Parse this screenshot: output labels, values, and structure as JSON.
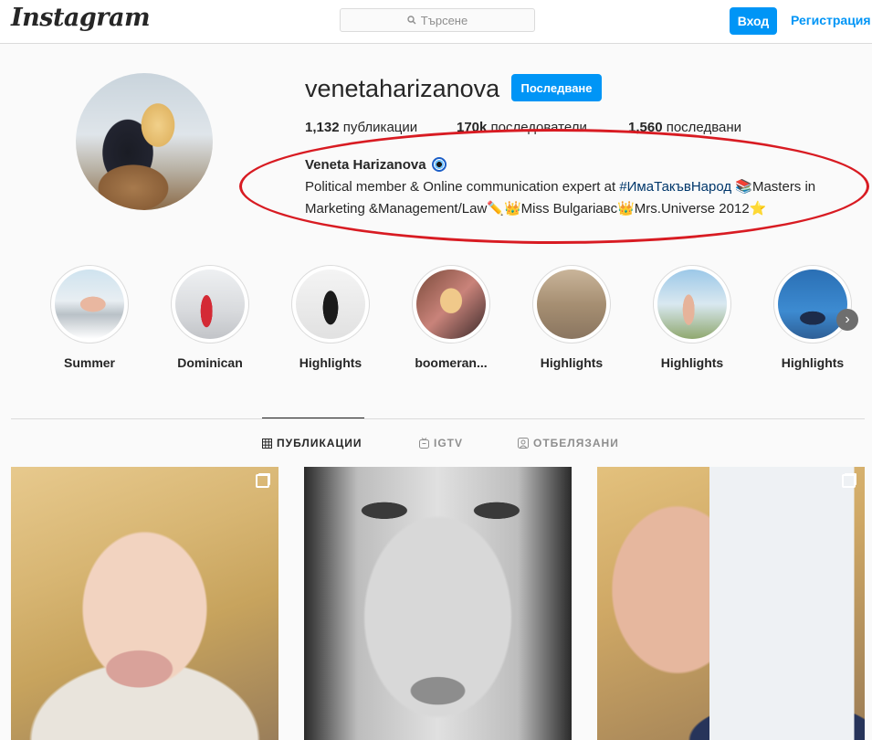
{
  "header": {
    "logo": "Instagram",
    "search_placeholder": "Търсене",
    "login_label": "Вход",
    "register_label": "Регистрация"
  },
  "profile": {
    "username": "venetaharizanova",
    "follow_label": "Последване",
    "stats": [
      {
        "count": "1,132",
        "label": "публикации"
      },
      {
        "count": "170k",
        "label": "последователи"
      },
      {
        "count": "1,560",
        "label": "последвани"
      }
    ],
    "full_name": "Veneta Harizanova",
    "bio_part1": "Political member & Online communication expert at ",
    "bio_hashtag": "#ИмаТакъвНарод",
    "bio_part2": " 📚Masters in Marketing &Management/Law✏️👑Miss Bulgariaвc👑Mrs.Universe 2012⭐"
  },
  "highlights": [
    {
      "label": "Summer"
    },
    {
      "label": "Dominican"
    },
    {
      "label": "Highlights"
    },
    {
      "label": "boomeran..."
    },
    {
      "label": "Highlights"
    },
    {
      "label": "Highlights"
    },
    {
      "label": "Highlights"
    }
  ],
  "tabs": [
    {
      "label": "ПУБЛИКАЦИИ",
      "icon": "grid-icon"
    },
    {
      "label": "IGTV",
      "icon": "igtv-icon"
    },
    {
      "label": "ОТБЕЛЯЗАНИ",
      "icon": "tagged-icon"
    }
  ],
  "colors": {
    "accent": "#0095f6",
    "annotation": "#d81b22",
    "hashtag": "#00376b"
  }
}
